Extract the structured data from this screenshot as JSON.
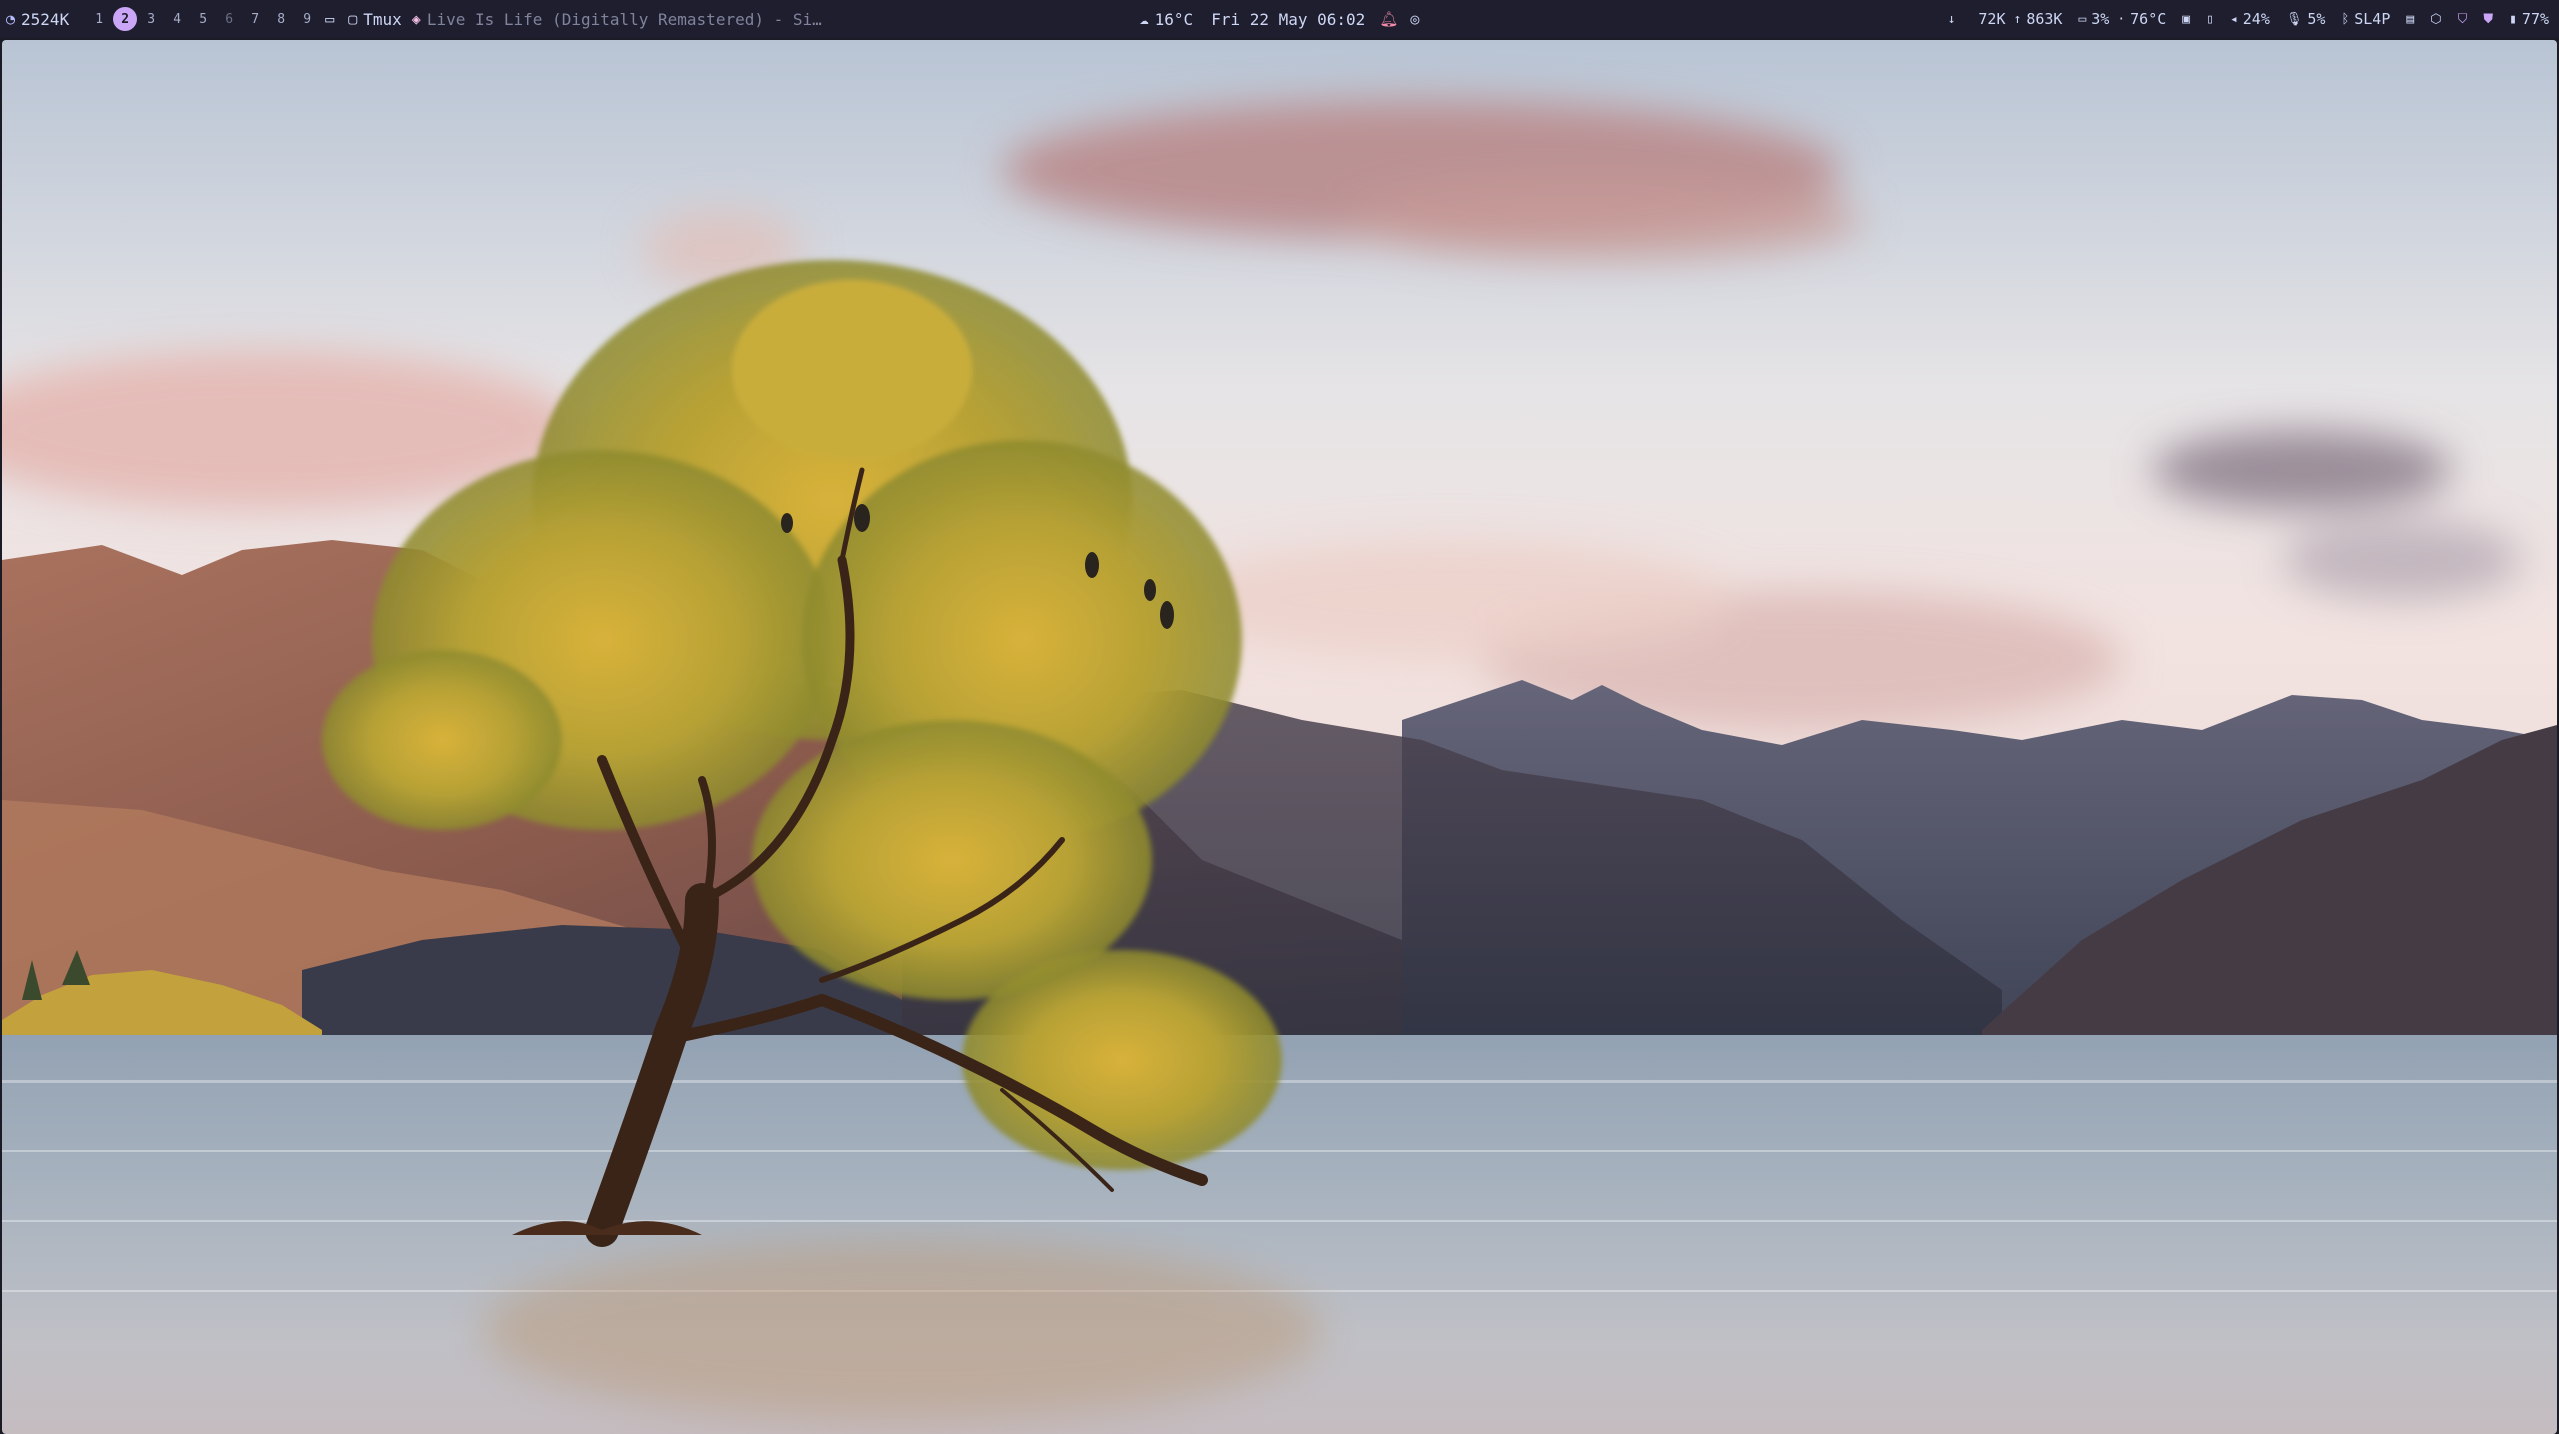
{
  "topbar": {
    "memory": "2524K",
    "workspaces": [
      {
        "label": "1",
        "state": "normal"
      },
      {
        "label": "2",
        "state": "active"
      },
      {
        "label": "3",
        "state": "normal"
      },
      {
        "label": "4",
        "state": "normal"
      },
      {
        "label": "5",
        "state": "normal"
      },
      {
        "label": "6",
        "state": "dim"
      },
      {
        "label": "7",
        "state": "normal"
      },
      {
        "label": "8",
        "state": "normal"
      },
      {
        "label": "9",
        "state": "normal"
      }
    ],
    "app_name": "Tmux",
    "window_title": "Live Is Life (Digitally Remastered) - Si…",
    "weather": "16°C",
    "clock": "Fri 22 May 06:02",
    "net_down": "72K",
    "net_up": "863K",
    "cpu": "3%",
    "temperature": "76°C",
    "volume": "24%",
    "mic": "5%",
    "bluetooth": "SL4P",
    "battery": "77%"
  },
  "colors": {
    "bar_bg": "#1e1e2e",
    "accent": "#cba6f7",
    "text": "#cdd6f4"
  },
  "wallpaper": {
    "subject": "lone willow tree standing in a calm lake with mountains at sunrise"
  }
}
